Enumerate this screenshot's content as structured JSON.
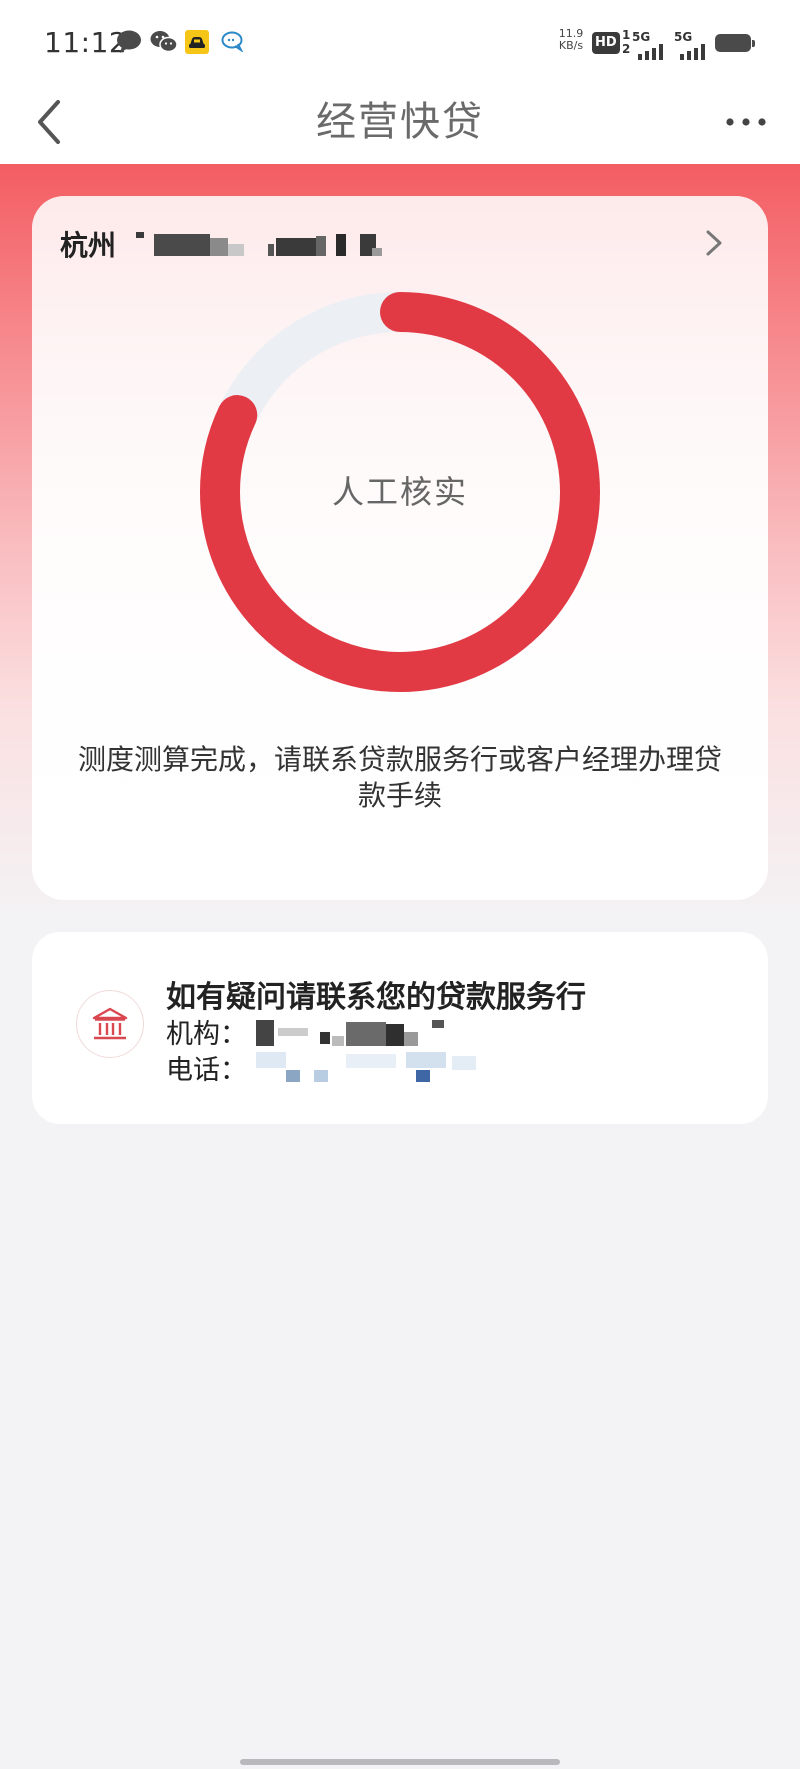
{
  "status_bar": {
    "time": "11:12",
    "net_speed_value": "11.9",
    "net_speed_unit": "KB/s",
    "hd_badge": "HD",
    "sim_top": "1",
    "sim_bottom": "2",
    "network_1": "5G",
    "network_2": "5G",
    "icons": [
      "message-bubble-icon",
      "wechat-icon",
      "car-app-icon",
      "chat-bubble-icon",
      "signal-icon",
      "battery-icon"
    ]
  },
  "nav": {
    "title": "经营快贷",
    "back_icon": "chevron-left-icon",
    "more_icon": "more-dots-icon"
  },
  "status_card": {
    "company_name_visible": "杭州",
    "ring_label": "人工核实",
    "progress_fraction": 0.82,
    "message": "测度测算完成，请联系贷款服务行或客户经理办理贷款手续"
  },
  "contact_card": {
    "title": "如有疑问请联系您的贷款服务行",
    "org_label": "机构：",
    "phone_label": "电话：",
    "icon": "bank-icon"
  },
  "colors": {
    "accent": "#e23a45",
    "ring_track": "#eceff3",
    "hero_top": "#f35d62"
  }
}
